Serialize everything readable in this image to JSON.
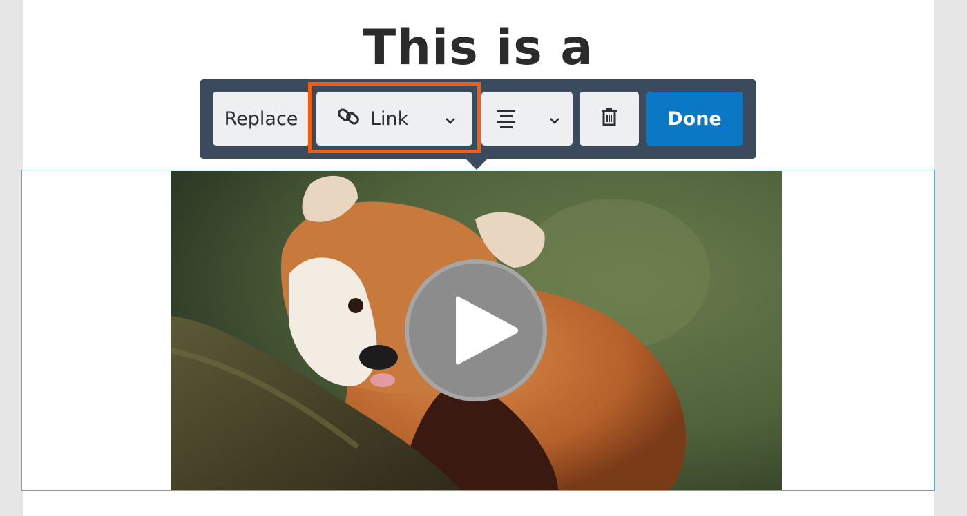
{
  "document": {
    "heading": "This is a"
  },
  "toolbar": {
    "replace_label": "Replace",
    "link_label": "Link",
    "done_label": "Done"
  },
  "icons": {
    "link": "link-icon",
    "chevron": "chevron-down-icon",
    "align": "align-center-icon",
    "delete": "trash-icon",
    "play": "play-icon"
  },
  "colors": {
    "toolbar_bg": "#3b4a5c",
    "done_bg": "#0b78c5",
    "highlight": "#ff5a00",
    "selection_border": "#5aa7d8"
  }
}
